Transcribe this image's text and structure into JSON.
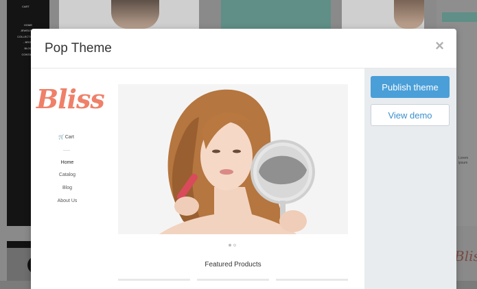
{
  "background_page": {
    "nav_items": [
      "CART",
      "HOME",
      "JEWELRY +",
      "COLLECTIONS +",
      "- BROC",
      "BLOG",
      "CONTACT"
    ],
    "logo_text": "Bliss",
    "right_text": "Lorem ipsum"
  },
  "modal": {
    "title": "Pop Theme",
    "close_label": "×",
    "preview": {
      "logo": "Bliss",
      "cart_label": "Cart",
      "nav_items": [
        {
          "label": "Home",
          "active": true
        },
        {
          "label": "Catalog",
          "active": false
        },
        {
          "label": "Blog",
          "active": false
        },
        {
          "label": "About Us",
          "active": false
        }
      ],
      "hero_image": "woman-with-mirror-photo",
      "carousel_slides": 2,
      "carousel_active": 1,
      "featured_heading": "Featured Products"
    },
    "actions": {
      "publish_label": "Publish theme",
      "demo_label": "View demo"
    }
  },
  "colors": {
    "accent": "#4a9fd8",
    "logo": "#ef8069",
    "sidebar_bg": "#e9ecef"
  }
}
